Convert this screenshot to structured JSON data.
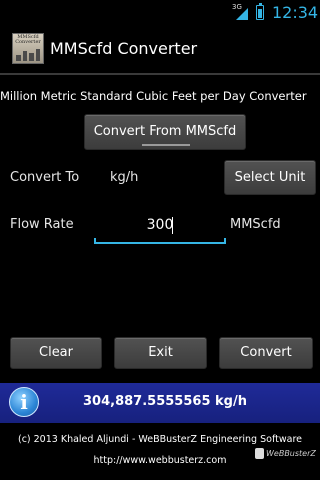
{
  "status_bar": {
    "network": "3G",
    "time": "12:34",
    "colors": {
      "accent": "#35b5e5"
    }
  },
  "app": {
    "title": "MMScfd Converter",
    "icon_label": "MMScfd Converter"
  },
  "subtitle": "Million Metric Standard Cubic Feet per Day Converter",
  "convert_from_button": "Convert From MMScfd",
  "convert_to": {
    "label": "Convert To",
    "value": "kg/h",
    "select_button": "Select Unit"
  },
  "flow_rate": {
    "label": "Flow Rate",
    "value": "300",
    "unit": "MMScfd"
  },
  "actions": {
    "clear": "Clear",
    "exit": "Exit",
    "convert": "Convert"
  },
  "result": {
    "text": "304,887.5555565 kg/h",
    "icon": "info-icon",
    "colors": {
      "background": "#1f2a98"
    }
  },
  "footer": {
    "copyright": "(c) 2013 Khaled Aljundi - WeBBusterZ Engineering Software",
    "url": "http://www.webbusterz.com"
  },
  "watermark": "WeBBusterZ"
}
